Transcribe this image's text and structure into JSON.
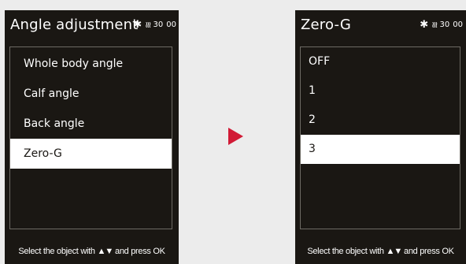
{
  "left_screen": {
    "title": "Angle adjustment",
    "status": {
      "bluetooth": "bluetooth-icon",
      "heat": "heat-wave-icon",
      "value1": "30",
      "value2": "00"
    },
    "items": [
      "Whole body angle",
      "Calf angle",
      "Back angle",
      "Zero-G"
    ],
    "selected_index": 3,
    "footer": {
      "prefix": "Select the object with",
      "arrows": "▲▼",
      "suffix": "and press OK"
    }
  },
  "right_screen": {
    "title": "Zero-G",
    "status": {
      "bluetooth": "bluetooth-icon",
      "heat": "heat-wave-icon",
      "value1": "30",
      "value2": "00"
    },
    "items": [
      "OFF",
      "1",
      "2",
      "3"
    ],
    "selected_index": 3,
    "footer": {
      "prefix": "Select the object with",
      "arrows": "▲▼",
      "suffix": "and press OK"
    }
  },
  "arrow": {
    "icon": "play-triangle-icon",
    "color": "#d11a36"
  },
  "colors": {
    "screen_bg": "#1a1713",
    "selected_bg": "#ffffff",
    "background": "#ececec"
  }
}
